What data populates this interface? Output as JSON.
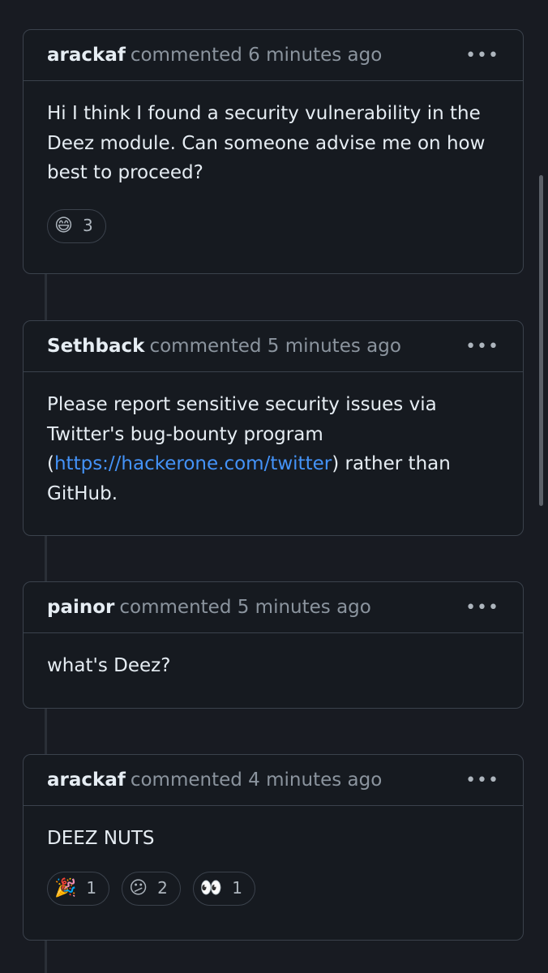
{
  "comments": [
    {
      "author": "arackaf",
      "meta": "commented 6 minutes ago",
      "body": "Hi I think I found a security vulnerability in the Deez module. Can someone advise me on how best to proceed?",
      "reactions": [
        {
          "icon": "grinning-face-emoji",
          "glyph": "😄",
          "count": "3"
        }
      ]
    },
    {
      "author": "Sethback",
      "meta": "commented 5 minutes ago",
      "body_before": "Please report sensitive security issues via Twitter's bug-bounty program (",
      "link": "https://hackerone.com/twitter",
      "body_after": ") rather than GitHub."
    },
    {
      "author": "painor",
      "meta": "commented 5 minutes ago",
      "body": "what's Deez?"
    },
    {
      "author": "arackaf",
      "meta": "commented 4 minutes ago",
      "body": "DEEZ NUTS",
      "reactions": [
        {
          "icon": "party-popper-emoji",
          "glyph": "🎉",
          "count": "1"
        },
        {
          "icon": "confused-face-emoji",
          "glyph": "😕",
          "count": "2"
        },
        {
          "icon": "eyes-emoji",
          "glyph": "👀",
          "count": "1"
        }
      ]
    }
  ],
  "more_icon": "more-options-icon",
  "more_glyph": "•••",
  "colors": {
    "background": "#181b22",
    "border": "#3b424c",
    "muted_text": "#8b949e",
    "link": "#4493f8"
  }
}
